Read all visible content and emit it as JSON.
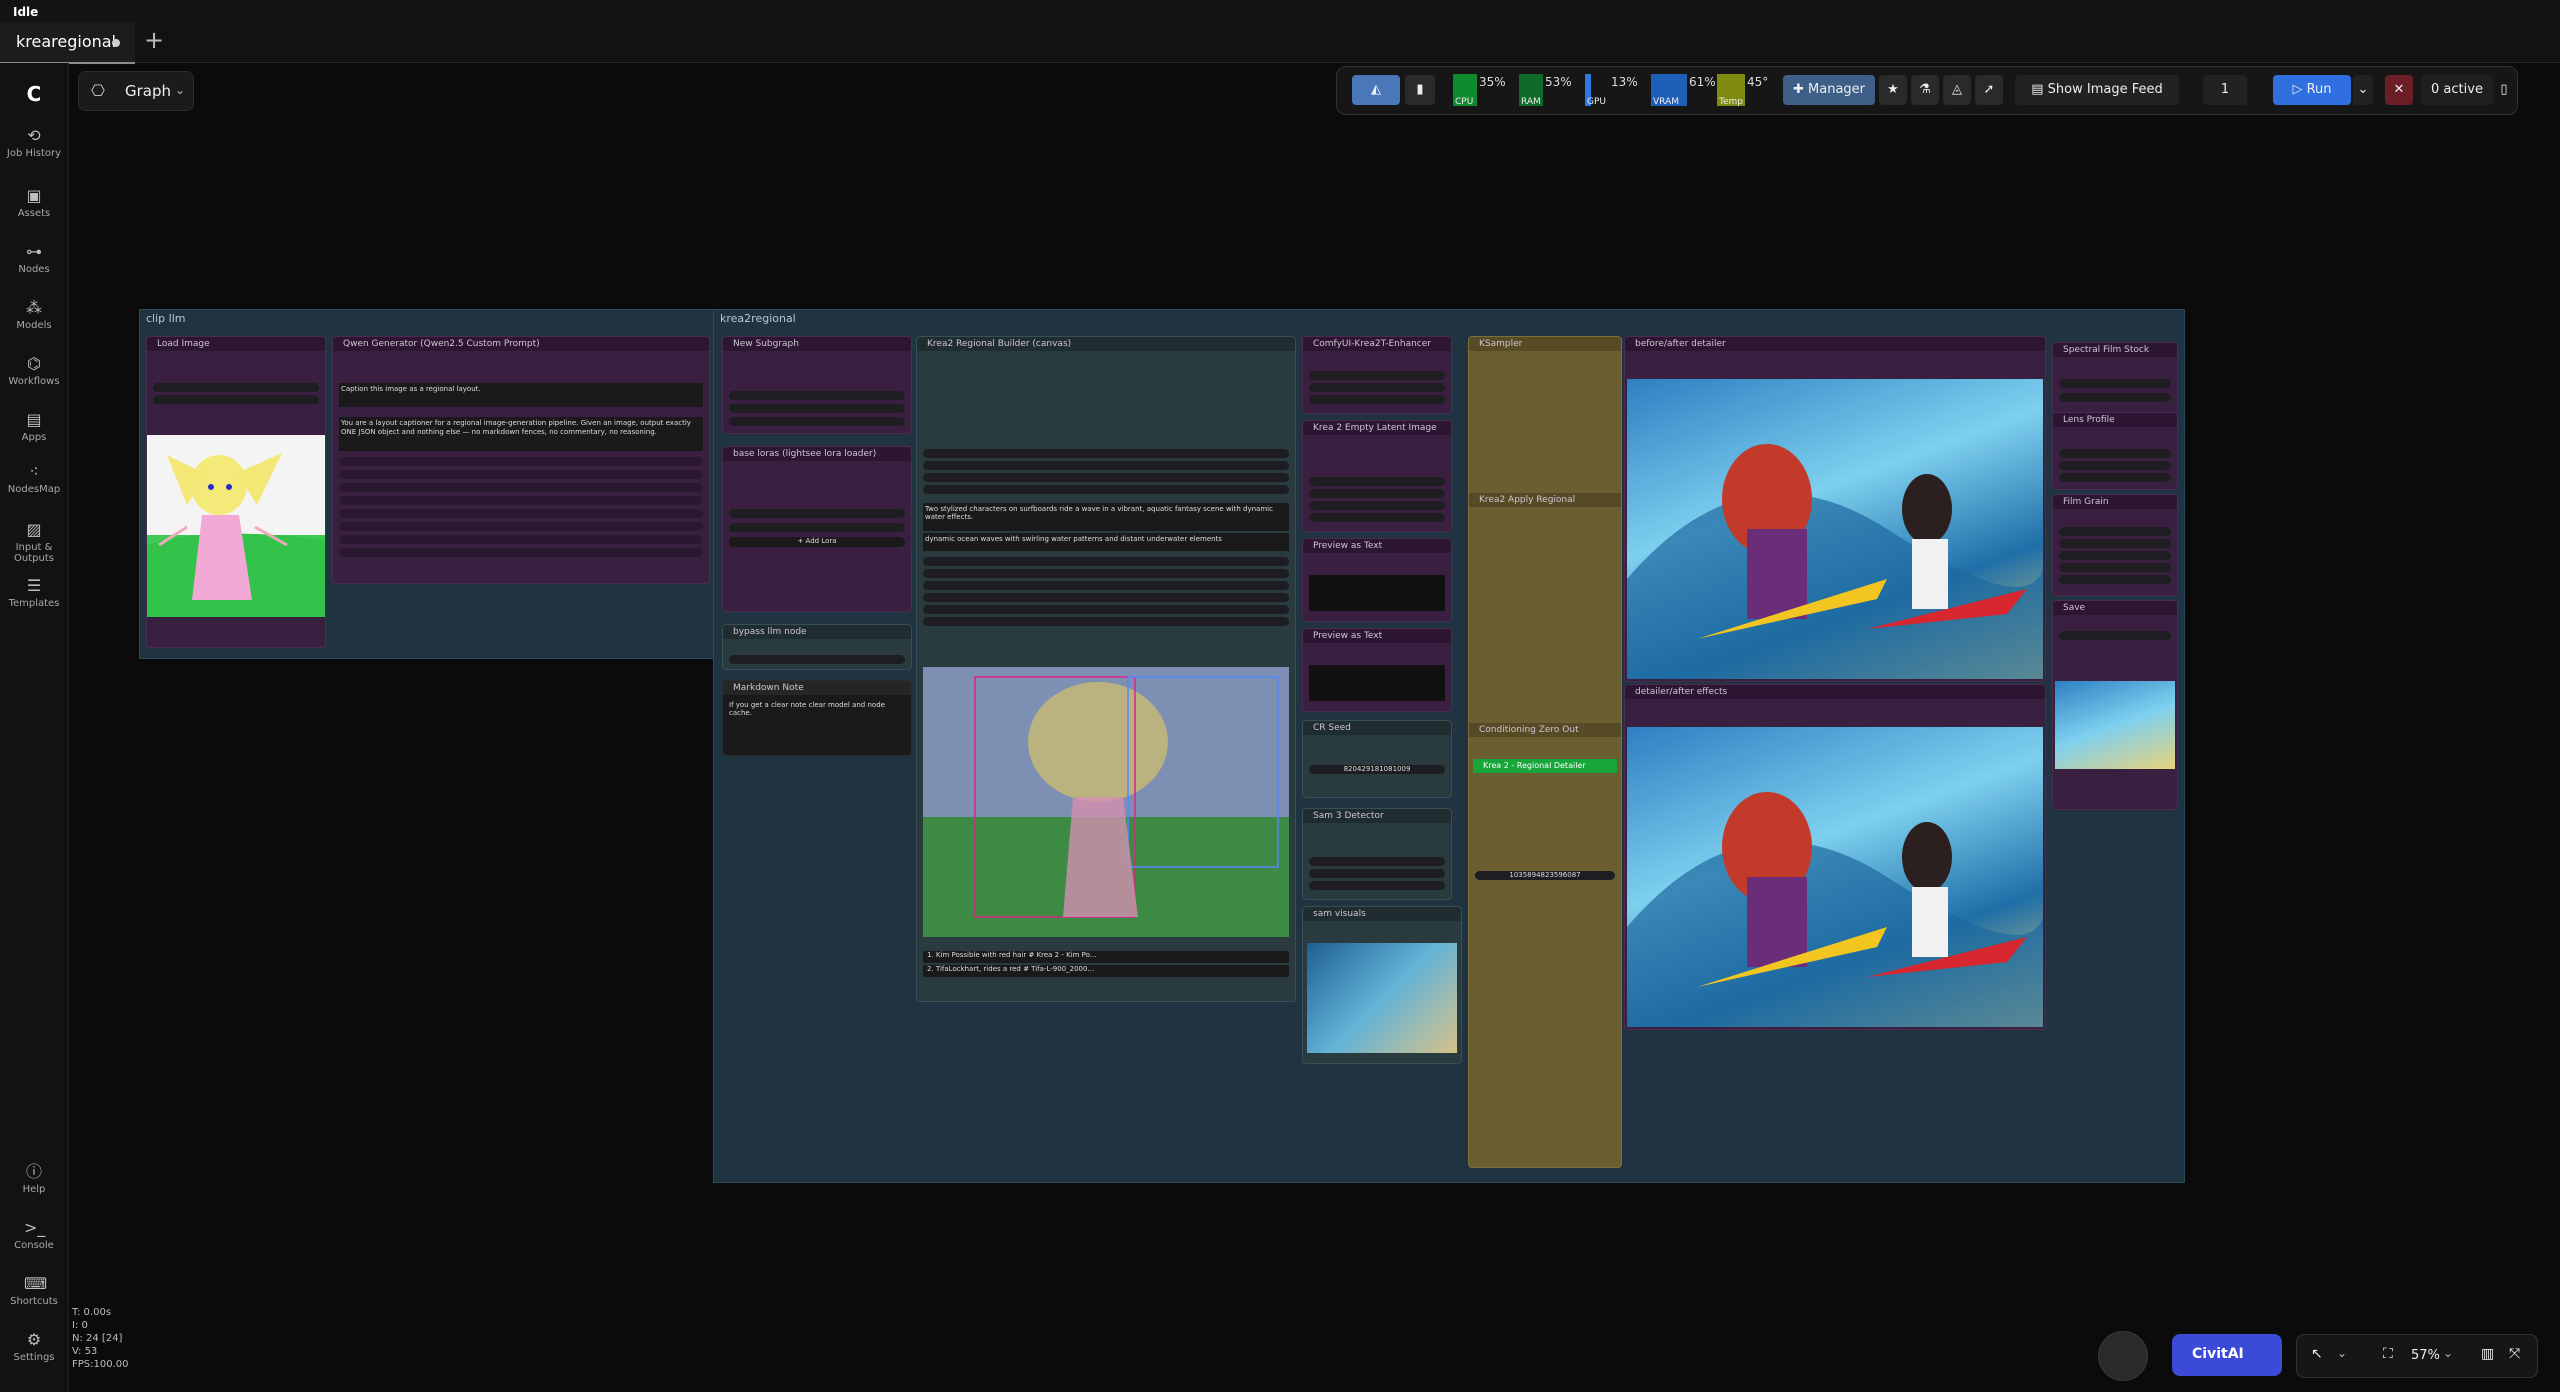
{
  "window": {
    "status": "Idle"
  },
  "tabs": [
    {
      "label": "krearegional"
    }
  ],
  "sidebar": {
    "items": [
      {
        "label": "Job History",
        "icon": "history-icon"
      },
      {
        "label": "Assets",
        "icon": "image-icon"
      },
      {
        "label": "Nodes",
        "icon": "nodes-icon"
      },
      {
        "label": "Models",
        "icon": "models-icon"
      },
      {
        "label": "Workflows",
        "icon": "workflow-icon"
      },
      {
        "label": "Apps",
        "icon": "apps-icon"
      },
      {
        "label": "NodesMap",
        "icon": "nodesmap-icon"
      },
      {
        "label": "Input & Outputs",
        "icon": "io-icon"
      },
      {
        "label": "Templates",
        "icon": "templates-icon"
      }
    ],
    "bottom": [
      {
        "label": "Help",
        "icon": "help-icon"
      },
      {
        "label": "Console",
        "icon": "console-icon"
      },
      {
        "label": "Shortcuts",
        "icon": "keyboard-icon"
      },
      {
        "label": "Settings",
        "icon": "gear-icon"
      }
    ]
  },
  "stats": {
    "t": "T: 0.00s",
    "i": "I: 0",
    "n": "N: 24 [24]",
    "v": "V: 53",
    "fps": "FPS:100.00"
  },
  "view": {
    "label": "Graph"
  },
  "toolbar": {
    "meters": [
      {
        "name": "CPU",
        "pct": "35%",
        "color": "#0f8a2d",
        "level": 0.35
      },
      {
        "name": "RAM",
        "pct": "53%",
        "color": "#0f6b2a",
        "level": 0.53
      },
      {
        "name": "GPU",
        "pct": "13%",
        "color": "#2d7be0",
        "level": 0.13
      },
      {
        "name": "VRAM",
        "pct": "61%",
        "color": "#1f5fb8",
        "level": 0.61
      },
      {
        "name": "Temp",
        "pct": "45°",
        "color": "#7f8a10",
        "level": 0.45
      }
    ],
    "manager": "Manager",
    "show_feed": "Show Image Feed",
    "batch": "1",
    "run": "Run",
    "active": "0 active"
  },
  "groups": {
    "clip": "clip llm",
    "krea": "krea2regional"
  },
  "nodes": {
    "load_image": "Load Image",
    "qwen": "Qwen Generator (Qwen2.5 Custom Prompt)",
    "new_subgraph": "New Subgraph",
    "base_loras": "base loras (lightsee lora loader)",
    "bypass": "bypass llm node",
    "markdown": "Markdown Note",
    "markdown_text": "If you get a clear note clear model and node cache.",
    "regional_builder": "Krea2 Regional Builder (canvas)",
    "enhancer": "ComfyUI-Krea2T-Enhancer",
    "empty_latent": "Krea 2 Empty Latent Image",
    "preview1": "Preview as Text",
    "preview2": "Preview as Text",
    "clip_seed": "CR Seed",
    "sam3": "Sam 3 Detector",
    "sam_visuals": "sam visuals",
    "ksampler": "KSampler",
    "apply_regional": "Krea2 Apply Regional",
    "cond_zero": "Conditioning Zero Out",
    "regional_detailer": "Krea 2 - Regional Detailer",
    "before_after": "before/after detailer",
    "detailer_effects": "detailer/after effects",
    "spectral": "Spectral Film Stock",
    "lens": "Lens Profile",
    "film_grain": "Film Grain",
    "save": "Save",
    "caption_prompt": "Caption this image as a regional layout.",
    "layout_prompt": "You are a layout captioner for a regional image-generation pipeline. Given an image, output exactly ONE JSON object and nothing else — no markdown fences, no commentary, no reasoning.",
    "scene_prompt": "Two stylized characters on surfboards ride a wave in a vibrant, aquatic fantasy scene with dynamic water effects.",
    "bg_prompt": "dynamic ocean waves with swirling water patterns and distant underwater elements",
    "region1": "1. Kim Possible with red hair  # Krea 2 - Kim Po...",
    "region2": "2. TifaLockhart, rides a red  # Tifa-L-900_2000...",
    "add_lora": "+ Add Lora",
    "seed_value": "820429181081009",
    "seed2": "1035894823596087"
  },
  "bottom": {
    "civitai": "CivitAI",
    "zoom": "57%"
  }
}
